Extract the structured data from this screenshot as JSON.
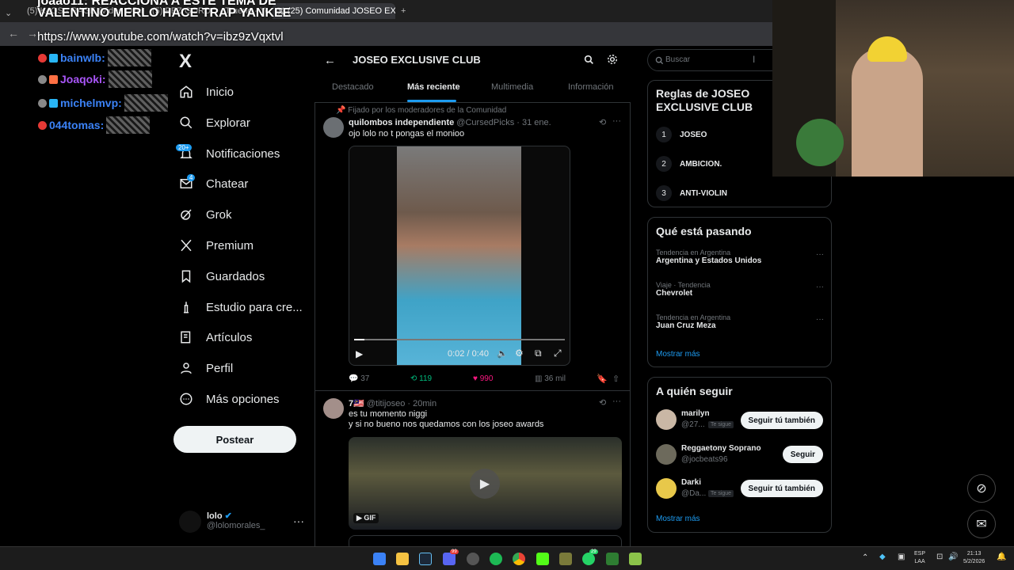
{
  "browser": {
    "tabs": [
      {
        "label": "(5) K4OS - RAGE (Video Oficial)",
        "color": "#ff0000"
      },
      {
        "label": "(5) PEZ GORDO - Trueno - YouT",
        "color": "#ff0000"
      },
      {
        "label": "(25) Comunidad JOSEO EXCLUS",
        "color": "#ffffff"
      }
    ],
    "new_tab": "+"
  },
  "stream": {
    "title_line1": "joaao11: REACCIONA A ESTE TEMA DE",
    "title_line2": "VALENTINO MERLO HACE TRAP YANKEE",
    "url": "https://www.youtube.com/watch?v=ibz9zVqxtvl"
  },
  "chat": [
    {
      "user": "bainwlb:",
      "color": "#3b82f6"
    },
    {
      "user": "Joaqoki:",
      "color": "#a855f7"
    },
    {
      "user": "michelmvp:",
      "color": "#3b82f6"
    },
    {
      "user": "044tomas:",
      "color": "#3b82f6"
    }
  ],
  "nav": {
    "logo": "X",
    "items": [
      "Inicio",
      "Explorar",
      "Notificaciones",
      "Chatear",
      "Grok",
      "Premium",
      "Guardados",
      "Estudio para cre...",
      "Artículos",
      "Perfil",
      "Más opciones"
    ],
    "notif_badge": "20+",
    "chat_badge": "4",
    "post_button": "Postear",
    "account_name": "lolo",
    "account_handle": "@lolomorales_"
  },
  "community": {
    "title": "JOSEO EXCLUSIVE CLUB",
    "tabs": [
      "Destacado",
      "Más reciente",
      "Multimedia",
      "Información"
    ],
    "active_tab": "Más reciente"
  },
  "posts": [
    {
      "pinned_label": "Fijado por los moderadores de la Comunidad",
      "name": "quilombos independiente",
      "handle": "@CursedPicks",
      "time": "· 31 ene.",
      "text": "ojo lolo no t pongas el monioo",
      "video_time": "0:02 / 0:40",
      "replies": "37",
      "reposts": "119",
      "likes": "990",
      "views": "36 mil"
    },
    {
      "name": "7🇲🇾",
      "handle": "@titijoseo",
      "time": "· 20min",
      "text1": "es tu momento niggi",
      "text2": "y si no bueno nos quedamos con los joseo awards",
      "gif_label": "GIF"
    }
  ],
  "search": {
    "placeholder": "Buscar"
  },
  "rules": {
    "title": "Reglas de JOSEO EXCLUSIVE CLUB",
    "items": [
      {
        "num": "1",
        "label": "JOSEO"
      },
      {
        "num": "2",
        "label": "AMBICION."
      },
      {
        "num": "3",
        "label": "ANTI-VIOLIN"
      }
    ]
  },
  "trends": {
    "title": "Qué está pasando",
    "items": [
      {
        "meta": "Tendencia en Argentina",
        "label": "Argentina y Estados Unidos"
      },
      {
        "meta": "Viaje · Tendencia",
        "label": "Chevrolet"
      },
      {
        "meta": "Tendencia en Argentina",
        "label": "Juan Cruz Meza"
      }
    ],
    "more": "Mostrar más"
  },
  "who_to_follow": {
    "title": "A quién seguir",
    "items": [
      {
        "name": "marilyn",
        "handle": "@27...",
        "follows_you": "Te sigue",
        "button": "Seguir tú también"
      },
      {
        "name": "Reggaetony Soprano",
        "handle": "@jocbeats96",
        "follows_you": "",
        "button": "Seguir"
      },
      {
        "name": "Darki",
        "handle": "@Da...",
        "follows_you": "Te sigue",
        "button": "Seguir tú también"
      }
    ],
    "more": "Mostrar más"
  },
  "taskbar": {
    "lang_top": "ESP",
    "lang_bottom": "LAA",
    "time": "21:13",
    "date": "5/2/2026",
    "discord_badge": "99",
    "whatsapp_badge": "29"
  }
}
